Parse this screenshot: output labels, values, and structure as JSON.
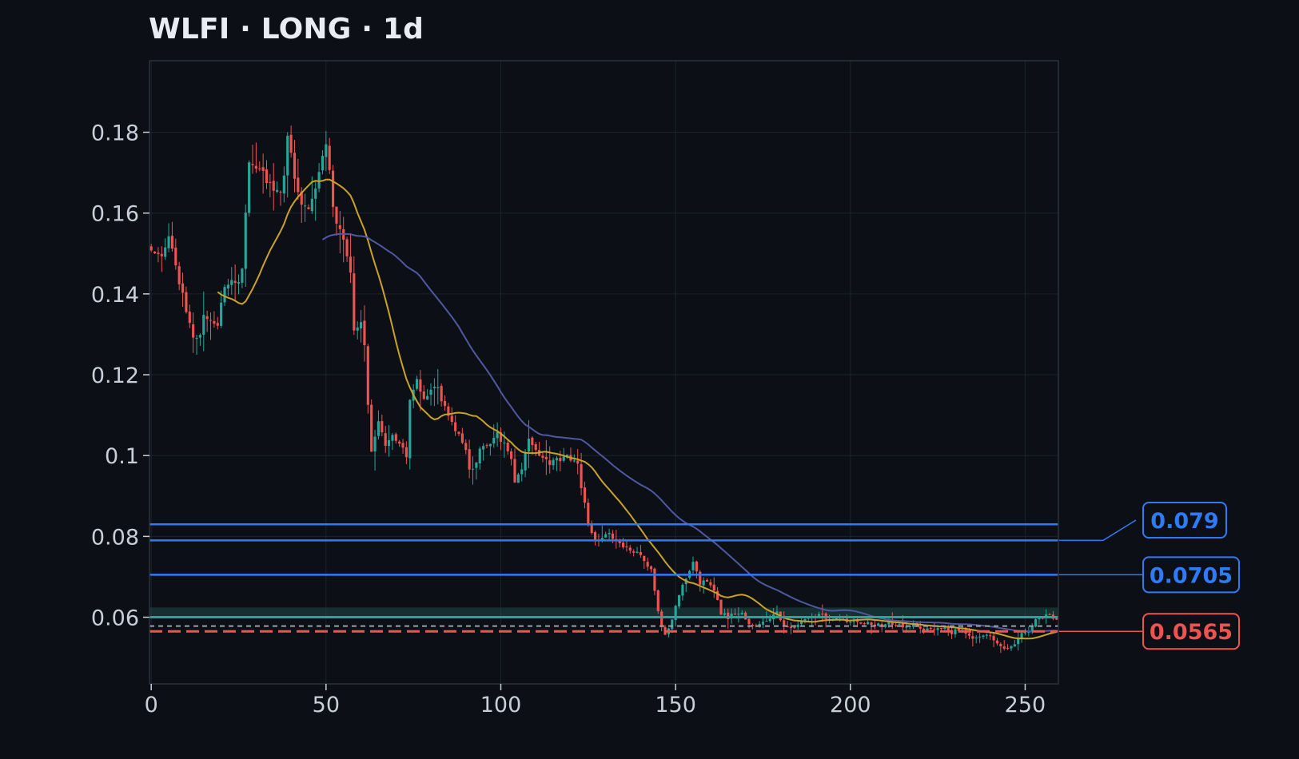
{
  "colors": {
    "background": "#0c0f16",
    "grid": "#1d222c",
    "frame": "#2c313b",
    "tick_text": "#c9ced8",
    "candle_up": "#26a69a",
    "candle_down": "#ef5350",
    "ma_fast": "#c9a227",
    "ma_slow": "#5058a0",
    "level_blue": "#2f7bf5",
    "zone": "#1f4a48",
    "zone_line": "#26a69a",
    "dotted": "#9aa0aa",
    "stop": "#ef5350"
  },
  "chart_data": {
    "type": "candlestick",
    "title": "WLFI · LONG · 1d",
    "xlabel": "",
    "ylabel": "",
    "xlim": [
      -0.5,
      259.5
    ],
    "ylim": [
      0.0435,
      0.1977
    ],
    "x_ticks": [
      0,
      50,
      100,
      150,
      200,
      250
    ],
    "y_ticks": [
      0.06,
      0.08,
      0.1,
      0.12,
      0.14,
      0.16,
      0.18
    ],
    "y_tick_labels": [
      "0.06",
      "0.08",
      "0.1",
      "0.12",
      "0.14",
      "0.16",
      "0.18"
    ],
    "grid": true,
    "close_anchors": [
      [
        0,
        0.151
      ],
      [
        3,
        0.15
      ],
      [
        5,
        0.154
      ],
      [
        7,
        0.146
      ],
      [
        9,
        0.141
      ],
      [
        11,
        0.132
      ],
      [
        13,
        0.128
      ],
      [
        15,
        0.134
      ],
      [
        17,
        0.133
      ],
      [
        19,
        0.133
      ],
      [
        21,
        0.141
      ],
      [
        23,
        0.143
      ],
      [
        25,
        0.144
      ],
      [
        26,
        0.147
      ],
      [
        28,
        0.172
      ],
      [
        31,
        0.171
      ],
      [
        33,
        0.168
      ],
      [
        35,
        0.167
      ],
      [
        37,
        0.164
      ],
      [
        38,
        0.17
      ],
      [
        39,
        0.18
      ],
      [
        41,
        0.168
      ],
      [
        43,
        0.163
      ],
      [
        45,
        0.162
      ],
      [
        47,
        0.167
      ],
      [
        49,
        0.173
      ],
      [
        50,
        0.177
      ],
      [
        51,
        0.17
      ],
      [
        52,
        0.162
      ],
      [
        53,
        0.158
      ],
      [
        55,
        0.153
      ],
      [
        57,
        0.145
      ],
      [
        58,
        0.13
      ],
      [
        60,
        0.133
      ],
      [
        61,
        0.128
      ],
      [
        62,
        0.113
      ],
      [
        63,
        0.101
      ],
      [
        65,
        0.108
      ],
      [
        67,
        0.103
      ],
      [
        69,
        0.106
      ],
      [
        71,
        0.103
      ],
      [
        73,
        0.1
      ],
      [
        74,
        0.113
      ],
      [
        76,
        0.118
      ],
      [
        78,
        0.114
      ],
      [
        80,
        0.117
      ],
      [
        82,
        0.116
      ],
      [
        84,
        0.112
      ],
      [
        86,
        0.108
      ],
      [
        88,
        0.105
      ],
      [
        90,
        0.101
      ],
      [
        91,
        0.096
      ],
      [
        93,
        0.099
      ],
      [
        95,
        0.103
      ],
      [
        97,
        0.102
      ],
      [
        99,
        0.105
      ],
      [
        101,
        0.103
      ],
      [
        103,
        0.099
      ],
      [
        104,
        0.094
      ],
      [
        106,
        0.097
      ],
      [
        108,
        0.104
      ],
      [
        110,
        0.102
      ],
      [
        112,
        0.099
      ],
      [
        114,
        0.098
      ],
      [
        116,
        0.099
      ],
      [
        118,
        0.1
      ],
      [
        120,
        0.099
      ],
      [
        122,
        0.098
      ],
      [
        123,
        0.092
      ],
      [
        124,
        0.088
      ],
      [
        125,
        0.083
      ],
      [
        127,
        0.079
      ],
      [
        129,
        0.08
      ],
      [
        131,
        0.081
      ],
      [
        133,
        0.079
      ],
      [
        135,
        0.078
      ],
      [
        137,
        0.077
      ],
      [
        139,
        0.076
      ],
      [
        141,
        0.074
      ],
      [
        143,
        0.072
      ],
      [
        144,
        0.067
      ],
      [
        145,
        0.061
      ],
      [
        146,
        0.058
      ],
      [
        147,
        0.056
      ],
      [
        149,
        0.059
      ],
      [
        151,
        0.066
      ],
      [
        153,
        0.069
      ],
      [
        155,
        0.074
      ],
      [
        157,
        0.068
      ],
      [
        159,
        0.069
      ],
      [
        161,
        0.067
      ],
      [
        163,
        0.061
      ],
      [
        165,
        0.06
      ],
      [
        167,
        0.061
      ],
      [
        169,
        0.061
      ],
      [
        171,
        0.058
      ],
      [
        173,
        0.058
      ],
      [
        175,
        0.059
      ],
      [
        177,
        0.06
      ],
      [
        179,
        0.061
      ],
      [
        181,
        0.058
      ],
      [
        183,
        0.057
      ],
      [
        185,
        0.058
      ],
      [
        187,
        0.059
      ],
      [
        189,
        0.06
      ],
      [
        191,
        0.061
      ],
      [
        193,
        0.06
      ],
      [
        195,
        0.059
      ],
      [
        197,
        0.06
      ],
      [
        199,
        0.059
      ],
      [
        201,
        0.059
      ],
      [
        203,
        0.058
      ],
      [
        205,
        0.059
      ],
      [
        207,
        0.058
      ],
      [
        209,
        0.058
      ],
      [
        211,
        0.059
      ],
      [
        213,
        0.058
      ],
      [
        215,
        0.058
      ],
      [
        217,
        0.058
      ],
      [
        219,
        0.058
      ],
      [
        221,
        0.057
      ],
      [
        223,
        0.057
      ],
      [
        225,
        0.057
      ],
      [
        227,
        0.057
      ],
      [
        229,
        0.056
      ],
      [
        231,
        0.057
      ],
      [
        233,
        0.056
      ],
      [
        235,
        0.055
      ],
      [
        237,
        0.055
      ],
      [
        239,
        0.056
      ],
      [
        241,
        0.054
      ],
      [
        243,
        0.053
      ],
      [
        245,
        0.052
      ],
      [
        247,
        0.053
      ],
      [
        249,
        0.056
      ],
      [
        251,
        0.056
      ],
      [
        253,
        0.059
      ],
      [
        255,
        0.06
      ],
      [
        257,
        0.061
      ],
      [
        259,
        0.059
      ]
    ],
    "levels": [
      {
        "value": 0.083,
        "kind": "solid",
        "color": "#2f7bf5"
      },
      {
        "value": 0.079,
        "kind": "solid",
        "color": "#2f7bf5",
        "label": "0.079"
      },
      {
        "value": 0.0705,
        "kind": "solid",
        "color": "#2f7bf5",
        "label": "0.0705"
      },
      {
        "value": 0.06,
        "kind": "zone-line",
        "color": "#26a69a"
      },
      {
        "value": 0.0578,
        "kind": "dotted",
        "color": "#9aa0aa"
      },
      {
        "value": 0.0565,
        "kind": "dashed",
        "color": "#ef5350",
        "label": "0.0565"
      }
    ],
    "zone": [
      0.06,
      0.0624
    ],
    "moving_averages": [
      {
        "period": 20,
        "color": "#c9a227"
      },
      {
        "period": 50,
        "color": "#5058a0"
      }
    ]
  }
}
